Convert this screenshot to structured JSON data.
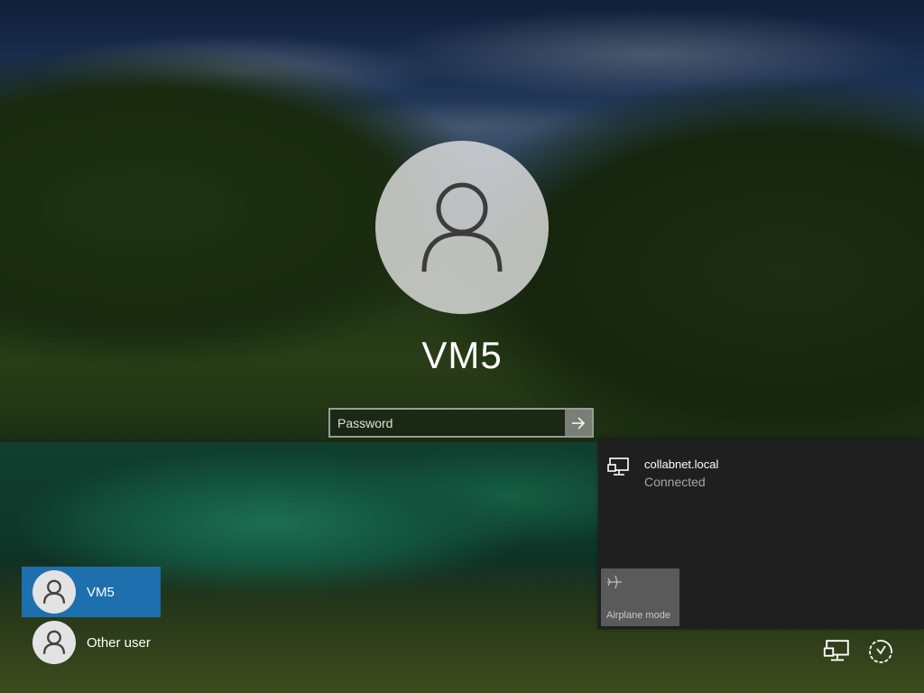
{
  "login": {
    "username": "VM5",
    "password_placeholder": "Password"
  },
  "users": [
    {
      "name": "VM5",
      "selected": true
    },
    {
      "name": "Other user",
      "selected": false
    }
  ],
  "network_flyout": {
    "network_name": "collabnet.local",
    "network_status": "Connected",
    "airplane_label": "Airplane mode"
  },
  "icons": {
    "large_avatar": "user-silhouette-icon",
    "submit": "arrow-right-icon",
    "network": "ethernet-network-icon",
    "airplane": "airplane-icon",
    "ease_of_access": "ease-of-access-icon",
    "power": "power-icon"
  },
  "colors": {
    "selected_user": "#1d70ad",
    "flyout_bg": "#1f1f1f",
    "airplane_tile": "#5a5a5a"
  }
}
